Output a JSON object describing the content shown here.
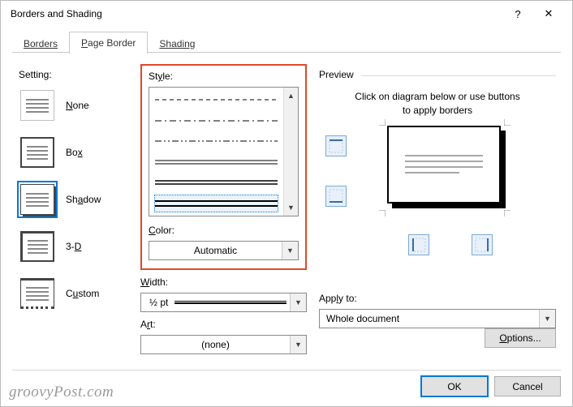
{
  "window": {
    "title": "Borders and Shading",
    "help": "?",
    "close": "✕"
  },
  "tabs": {
    "borders": "Borders",
    "page_border": "Page Border",
    "shading": "Shading"
  },
  "setting": {
    "heading": "Setting:",
    "none": "None",
    "box": "Box",
    "shadow": "Shadow",
    "threeD": "3-D",
    "custom": "Custom"
  },
  "style": {
    "label": "Style:",
    "color_label": "Color:",
    "color_value": "Automatic",
    "width_label": "Width:",
    "width_value": "½ pt",
    "art_label": "Art:",
    "art_value": "(none)"
  },
  "preview": {
    "heading": "Preview",
    "hint1": "Click on diagram below or use buttons",
    "hint2": "to apply borders"
  },
  "apply": {
    "label": "Apply to:",
    "value": "Whole document",
    "options": "Options..."
  },
  "footer": {
    "ok": "OK",
    "cancel": "Cancel"
  },
  "watermark": "groovyPost.com"
}
